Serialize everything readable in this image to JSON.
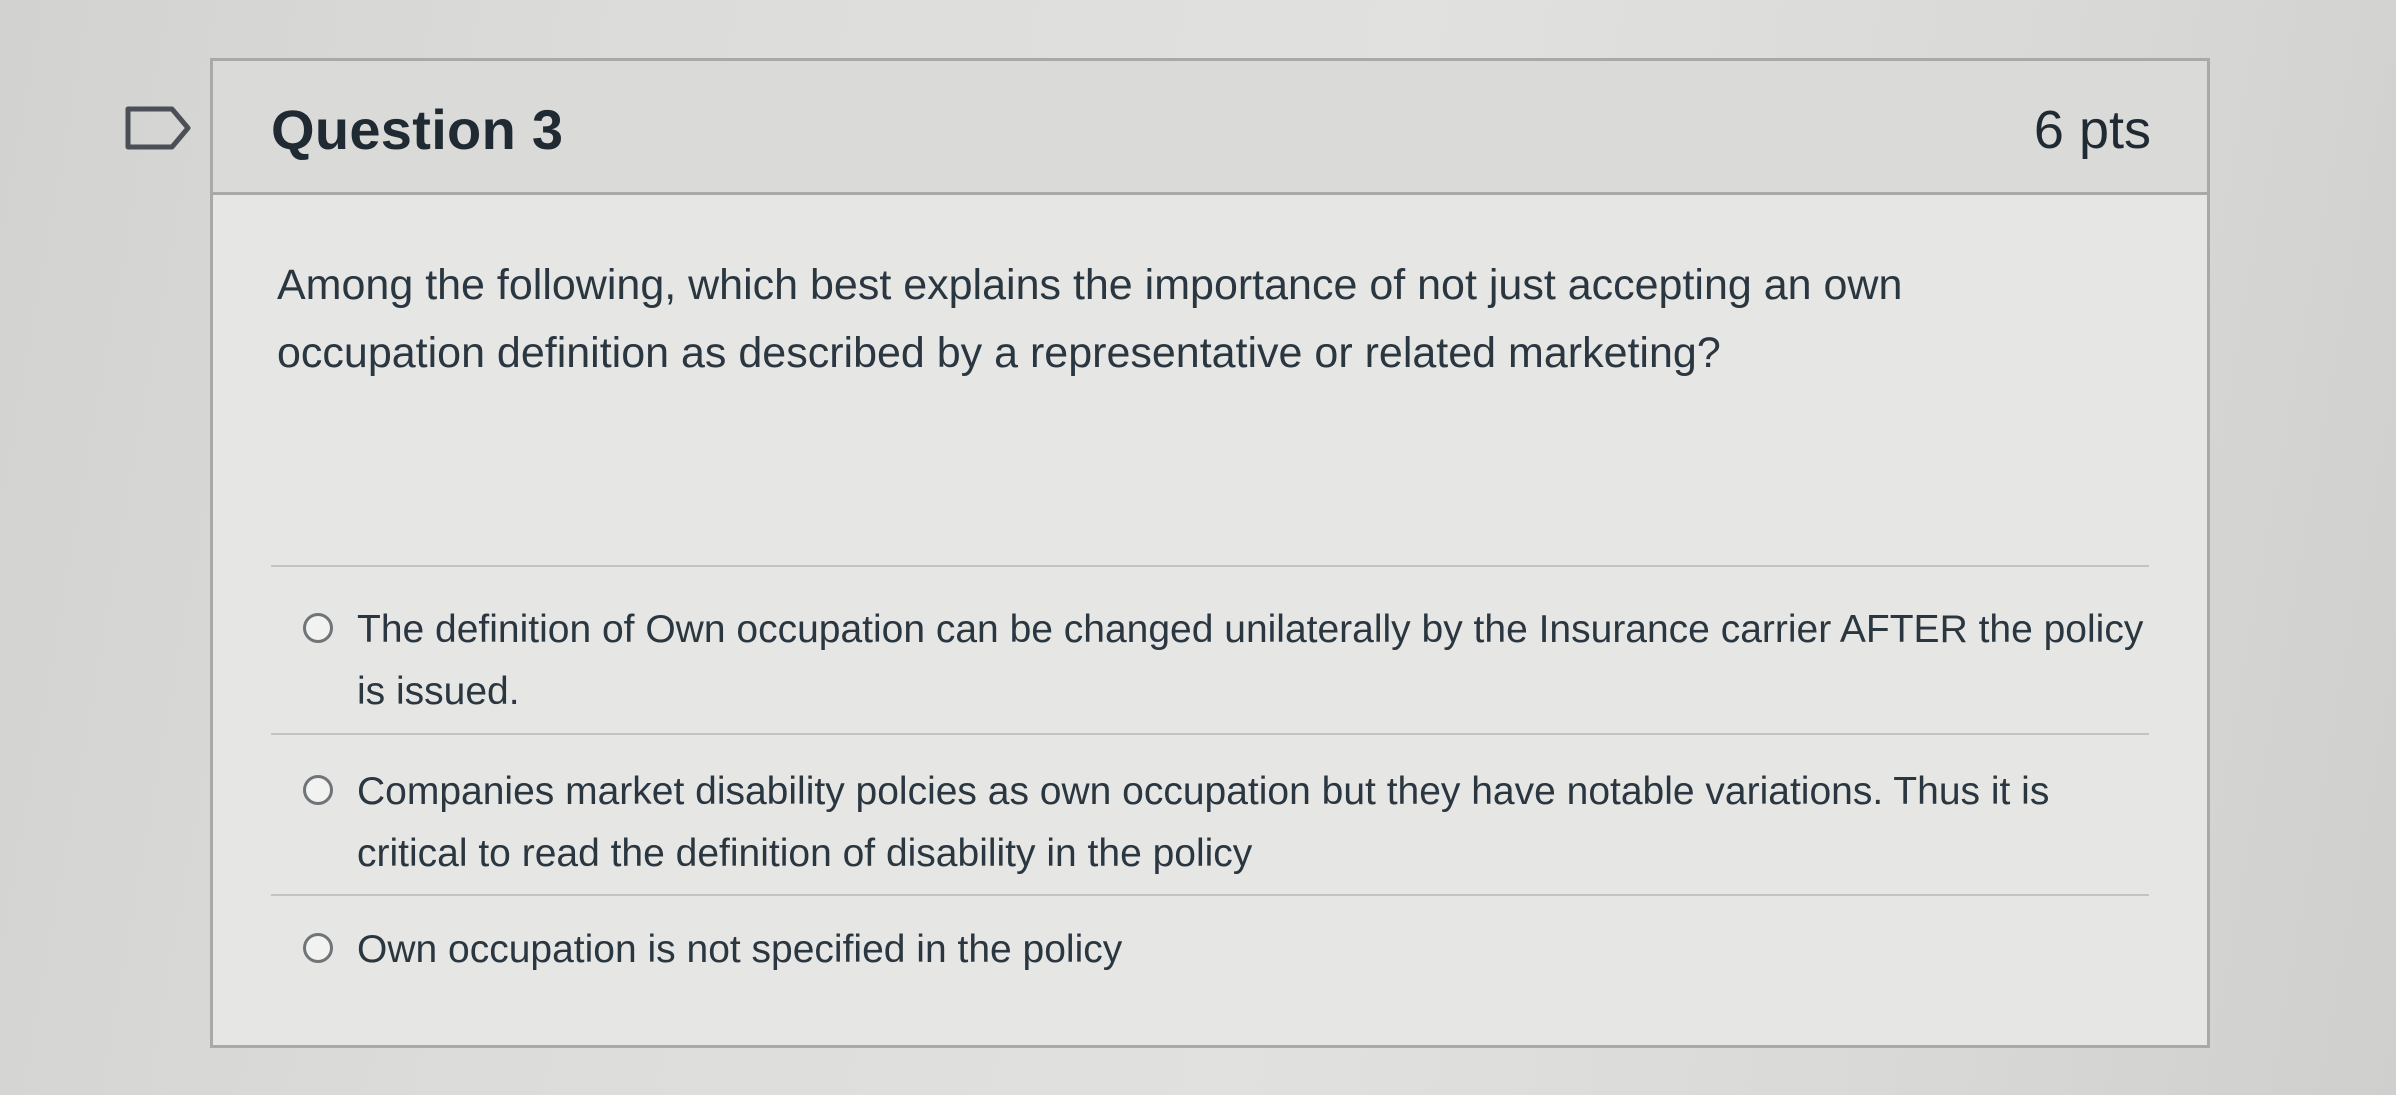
{
  "question": {
    "title": "Question 3",
    "points": "6 pts",
    "text": "Among the following, which best explains the importance of not just accepting an own occupation definition as described by a representative or related marketing?",
    "answers": [
      {
        "label": "The definition of Own occupation can be changed unilaterally by the Insurance carrier AFTER the policy is issued.",
        "selected": false
      },
      {
        "label": "Companies market disability polcies as own occupation but they have notable variations. Thus it is critical to read the definition of disability in the policy",
        "selected": false
      },
      {
        "label": "Own occupation is not specified in the policy",
        "selected": false
      }
    ]
  },
  "icons": {
    "flag": "flag-outline-icon",
    "radio": "radio-unchecked-icon"
  },
  "colors": {
    "text": "#2a3640",
    "border": "#a9aaa7",
    "header_bg": "#dadad8",
    "body_bg": "#e6e6e4"
  }
}
